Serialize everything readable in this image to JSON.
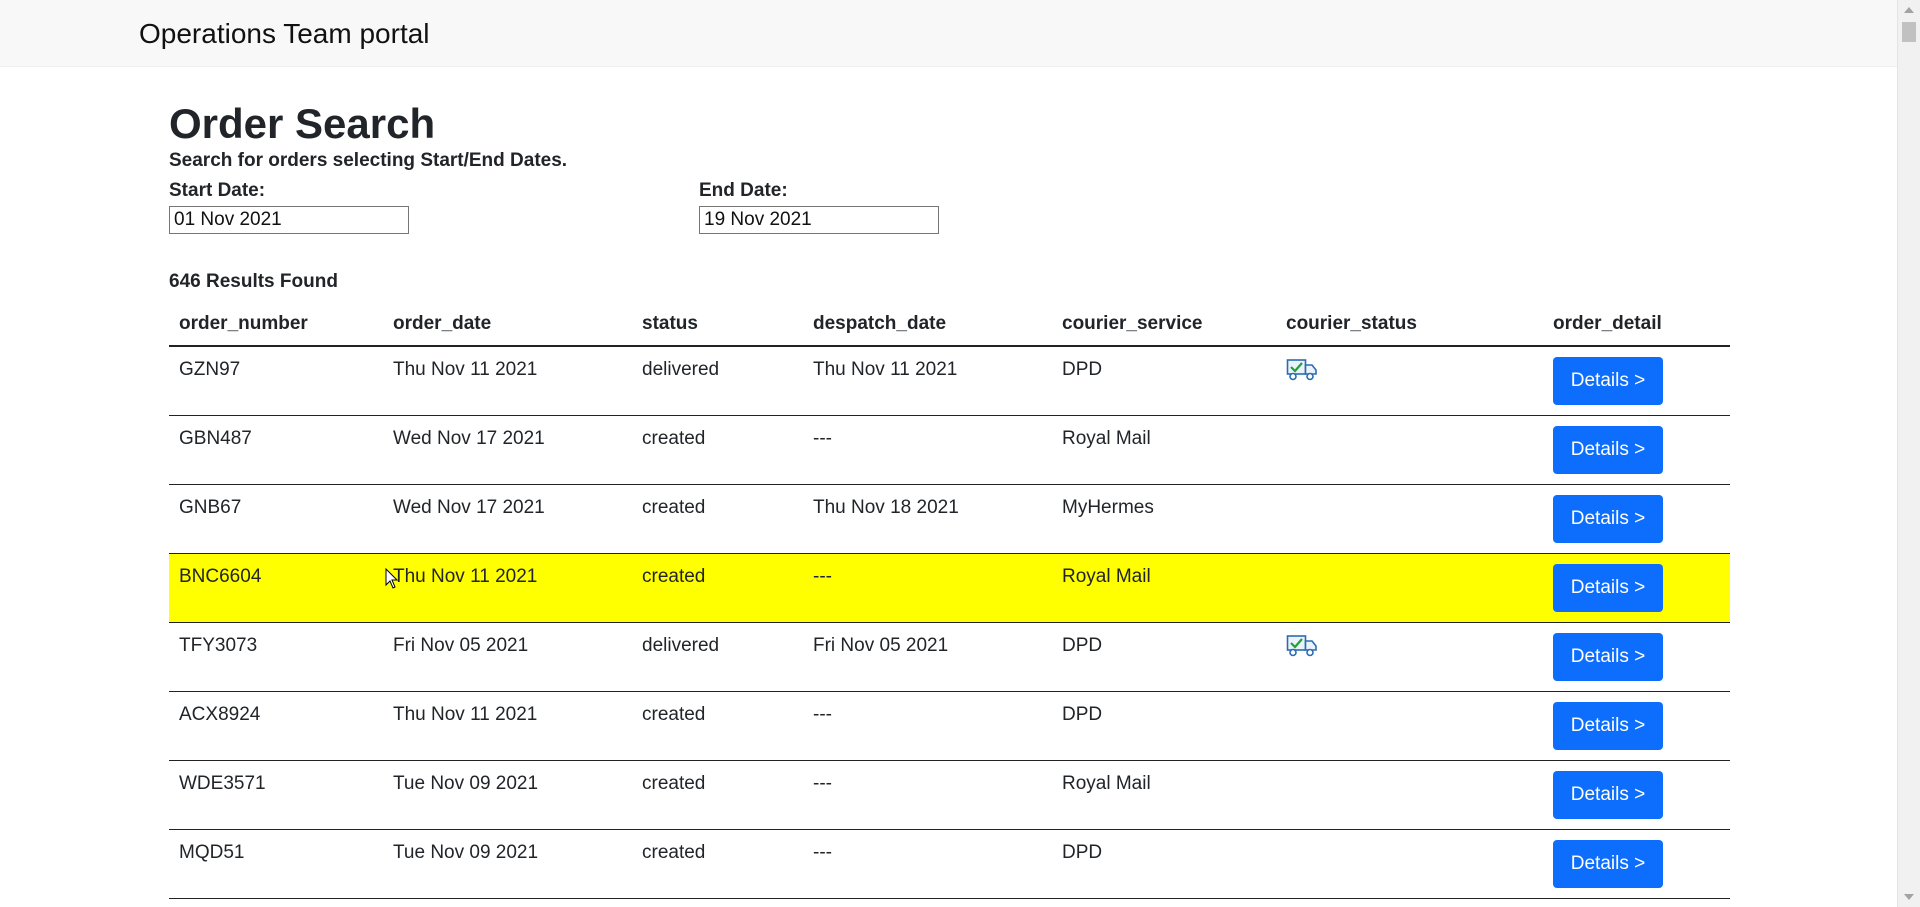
{
  "app": {
    "brand": "Operations Team portal"
  },
  "page": {
    "title": "Order Search",
    "subtitle": "Search for orders selecting Start/End Dates."
  },
  "filters": {
    "start_label": "Start Date:",
    "start_value": "01 Nov 2021",
    "end_label": "End Date:",
    "end_value": "19 Nov 2021"
  },
  "results": {
    "count_text": "646 Results Found",
    "highlight_color": "#ffff00",
    "button_color": "#0d6efd",
    "columns": [
      "order_number",
      "order_date",
      "status",
      "despatch_date",
      "courier_service",
      "courier_status",
      "order_detail"
    ],
    "rows": [
      {
        "order_number": "GZN97",
        "order_date": "Thu Nov 11 2021",
        "status": "delivered",
        "despatch_date": "Thu Nov 11 2021",
        "courier_service": "DPD",
        "courier_status_icon": "truck-delivered-icon",
        "details_label": "Details >"
      },
      {
        "order_number": "GBN487",
        "order_date": "Wed Nov 17 2021",
        "status": "created",
        "despatch_date": "---",
        "courier_service": "Royal Mail",
        "courier_status_icon": "",
        "details_label": "Details >"
      },
      {
        "order_number": "GNB67",
        "order_date": "Wed Nov 17 2021",
        "status": "created",
        "despatch_date": "Thu Nov 18 2021",
        "courier_service": "MyHermes",
        "courier_status_icon": "",
        "details_label": "Details >"
      },
      {
        "order_number": "BNC6604",
        "order_date": "Thu Nov 11 2021",
        "status": "created",
        "despatch_date": "---",
        "courier_service": "Royal Mail",
        "courier_status_icon": "",
        "details_label": "Details >",
        "highlighted": true
      },
      {
        "order_number": "TFY3073",
        "order_date": "Fri Nov 05 2021",
        "status": "delivered",
        "despatch_date": "Fri Nov 05 2021",
        "courier_service": "DPD",
        "courier_status_icon": "truck-delivered-icon",
        "details_label": "Details >"
      },
      {
        "order_number": "ACX8924",
        "order_date": "Thu Nov 11 2021",
        "status": "created",
        "despatch_date": "---",
        "courier_service": "DPD",
        "courier_status_icon": "",
        "details_label": "Details >"
      },
      {
        "order_number": "WDE3571",
        "order_date": "Tue Nov 09 2021",
        "status": "created",
        "despatch_date": "---",
        "courier_service": "Royal Mail",
        "courier_status_icon": "",
        "details_label": "Details >"
      },
      {
        "order_number": "MQD51",
        "order_date": "Tue Nov 09 2021",
        "status": "created",
        "despatch_date": "---",
        "courier_service": "DPD",
        "courier_status_icon": "",
        "details_label": "Details >"
      }
    ]
  }
}
